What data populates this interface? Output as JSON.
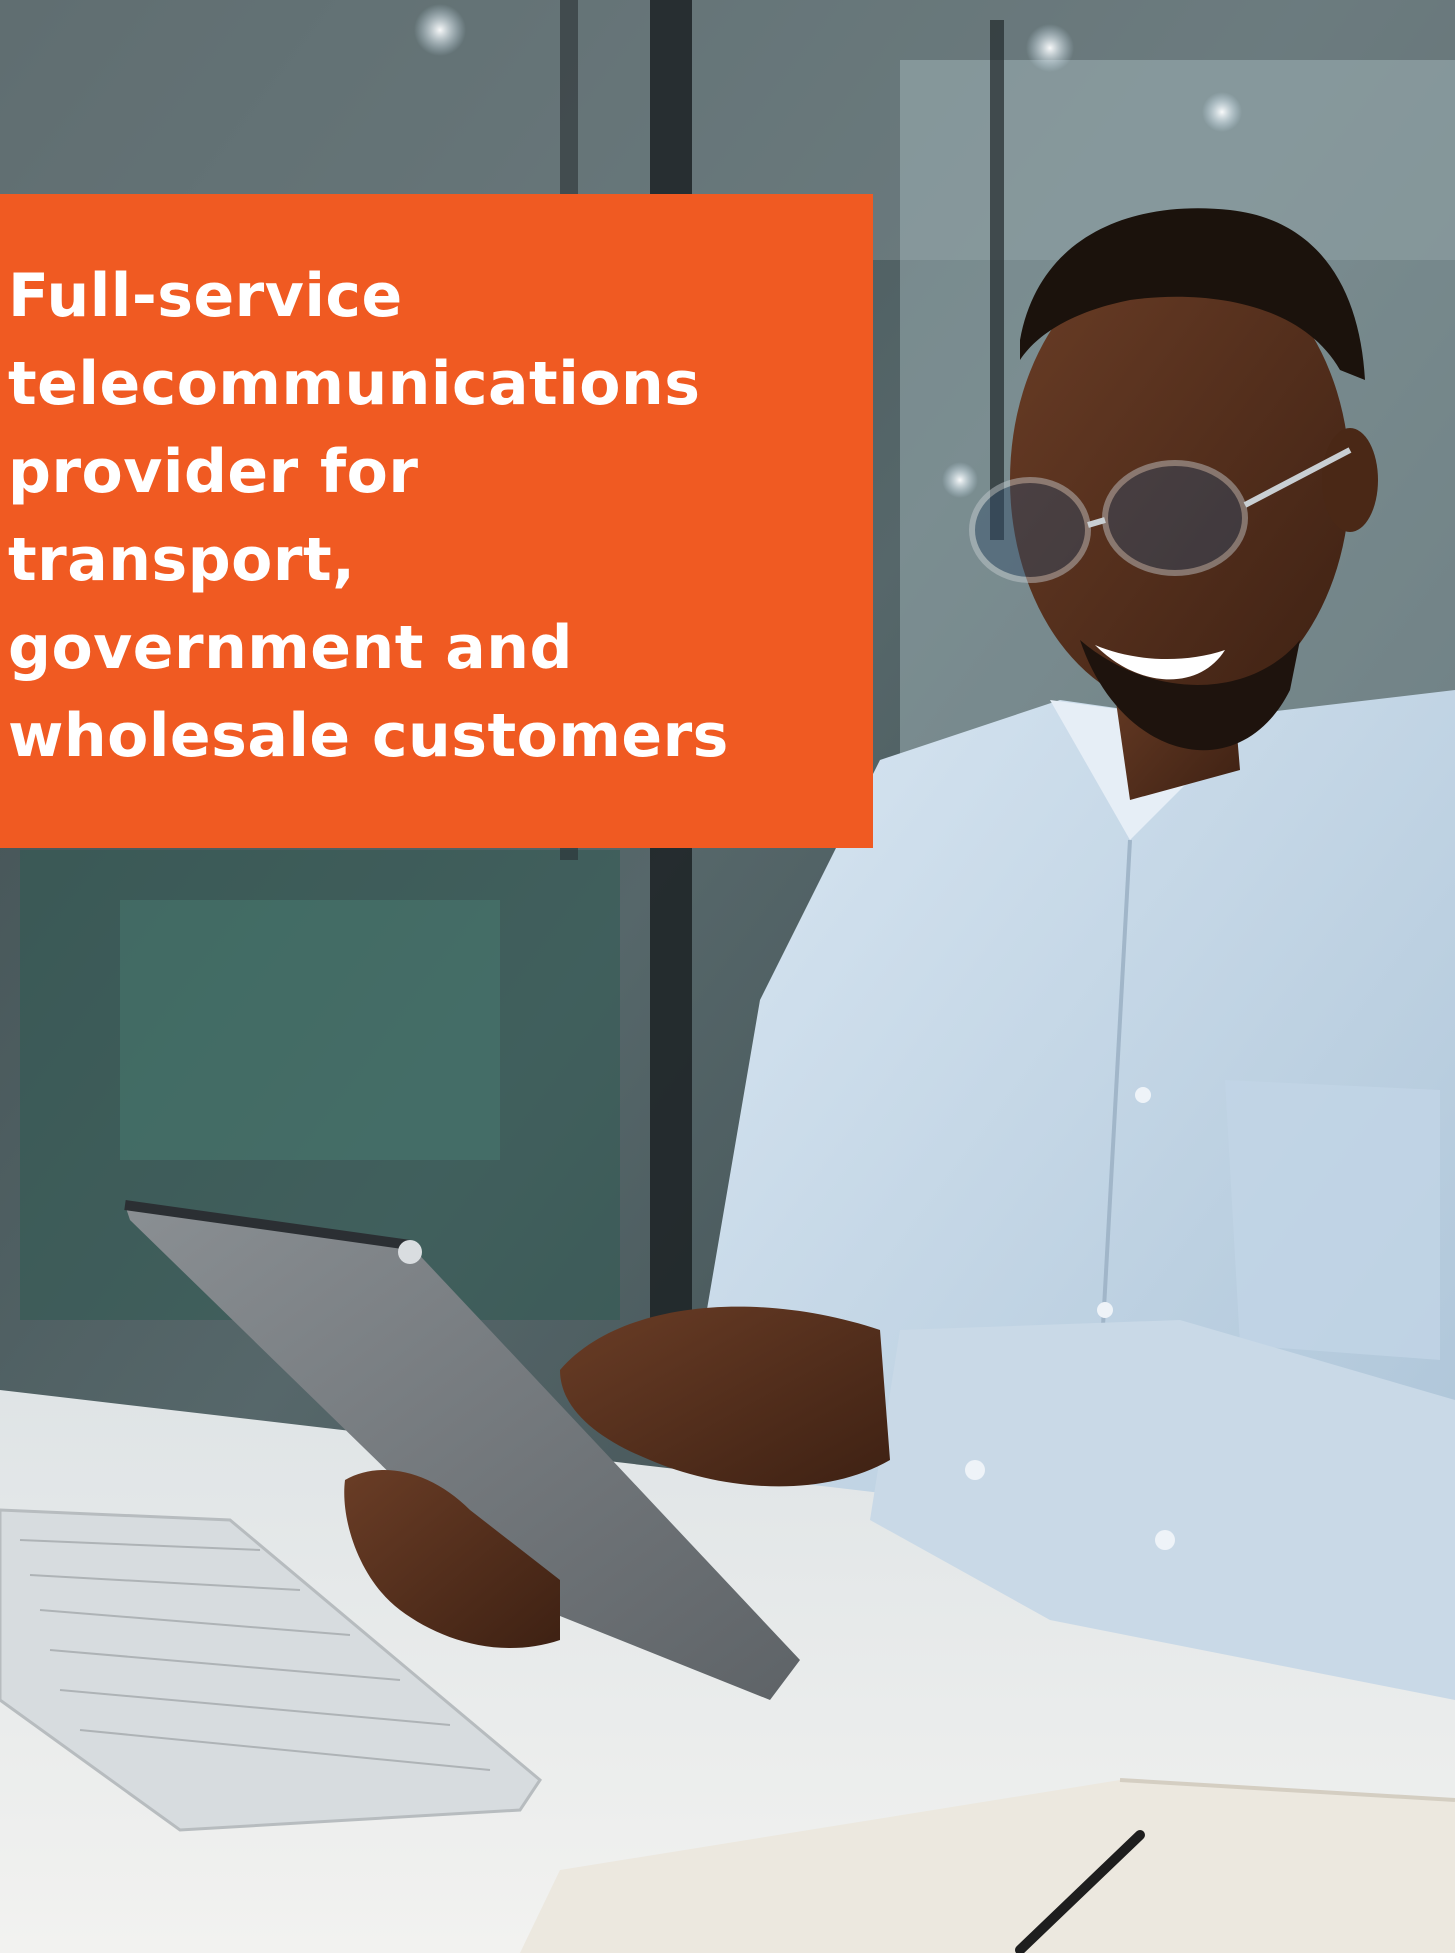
{
  "brand": {
    "accent_color": "#f05a22"
  },
  "headline": {
    "text": "Full-service\ntelecommunications\nprovider for\ntransport,\ngovernment and\nwholesale customers"
  },
  "photo": {
    "subject": "man-with-glasses-using-tablet-at-desk",
    "elements": [
      "tablet",
      "keyboard",
      "notebook",
      "pen",
      "glasses"
    ]
  }
}
